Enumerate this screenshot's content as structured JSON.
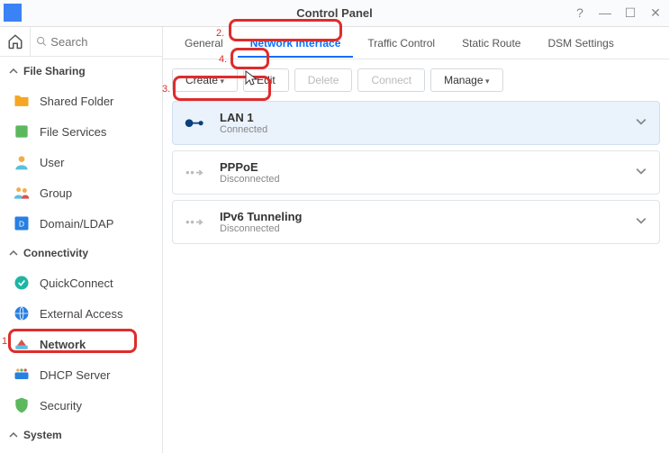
{
  "window": {
    "title": "Control Panel"
  },
  "search": {
    "placeholder": "Search"
  },
  "sidebar": {
    "sections": {
      "file_sharing": {
        "label": "File Sharing"
      },
      "connectivity": {
        "label": "Connectivity"
      },
      "system": {
        "label": "System"
      }
    },
    "items": {
      "shared_folder": "Shared Folder",
      "file_services": "File Services",
      "user": "User",
      "group": "Group",
      "domain_ldap": "Domain/LDAP",
      "quickconnect": "QuickConnect",
      "external_access": "External Access",
      "network": "Network",
      "dhcp_server": "DHCP Server",
      "security": "Security"
    }
  },
  "tabs": {
    "general": "General",
    "network_interface": "Network Interface",
    "traffic_control": "Traffic Control",
    "static_route": "Static Route",
    "dsm_settings": "DSM Settings"
  },
  "toolbar": {
    "create": "Create",
    "edit": "Edit",
    "delete": "Delete",
    "connect": "Connect",
    "manage": "Manage"
  },
  "interfaces": [
    {
      "name": "LAN 1",
      "status": "Connected",
      "type": "lan",
      "selected": true
    },
    {
      "name": "PPPoE",
      "status": "Disconnected",
      "type": "arrow",
      "selected": false
    },
    {
      "name": "IPv6 Tunneling",
      "status": "Disconnected",
      "type": "arrow",
      "selected": false
    }
  ],
  "annotations": {
    "1": "1.",
    "2": "2.",
    "3": "3.",
    "4": "4."
  }
}
